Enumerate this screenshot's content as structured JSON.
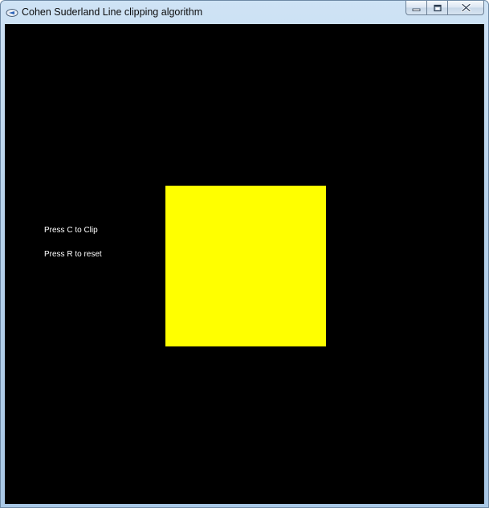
{
  "window": {
    "title": "Cohen Suderland Line clipping algorithm",
    "icon": "app-icon"
  },
  "caption_buttons": {
    "minimize": "minimize-icon",
    "maximize": "restore-icon",
    "close": "close-icon"
  },
  "canvas": {
    "background": "#000000",
    "instructions": {
      "clip": "Press C to Clip",
      "reset": "Press R to reset"
    },
    "clip_window_color": "#ffff00"
  }
}
